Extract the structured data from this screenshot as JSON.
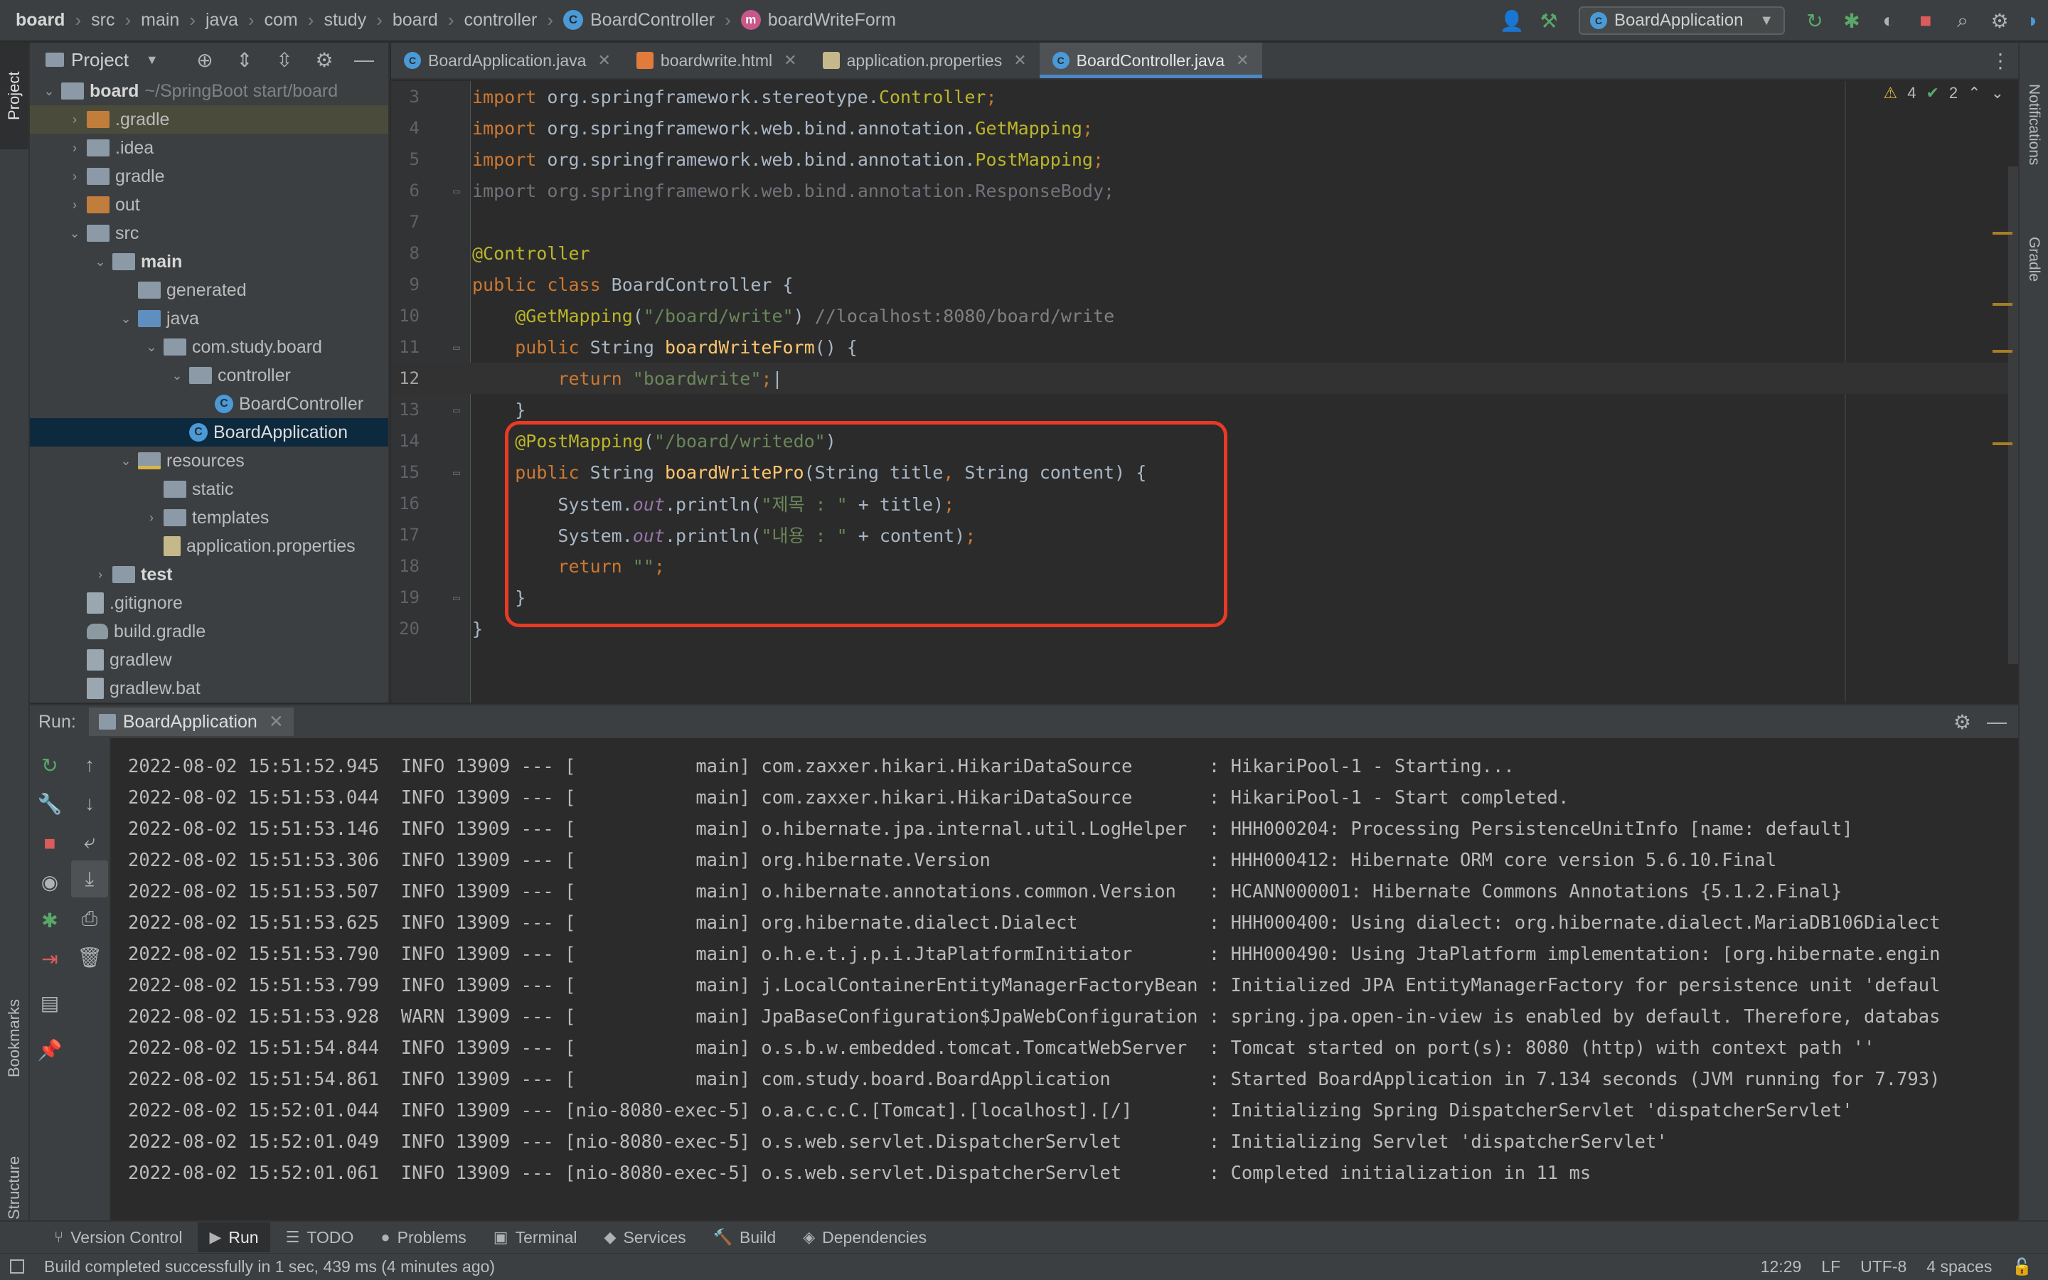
{
  "breadcrumbs": [
    "board",
    "src",
    "main",
    "java",
    "com",
    "study",
    "board",
    "controller",
    "BoardController",
    "boardWriteForm"
  ],
  "run_config": "BoardApplication",
  "icons": {
    "user": "user-icon",
    "build": "hammer-icon",
    "rerun": "rerun-icon",
    "debug": "bug-icon",
    "coverage": "coverage-icon",
    "stop": "stop-icon",
    "search": "search-icon",
    "settings": "gear-icon"
  },
  "left_tabs": {
    "project": "Project",
    "bookmarks": "Bookmarks",
    "structure": "Structure"
  },
  "right_tabs": {
    "notifications": "Notifications",
    "gradle": "Gradle"
  },
  "project": {
    "title": "Project",
    "tree": [
      {
        "label": "board",
        "hint": "~/SpringBoot start/board",
        "depth": 0,
        "arrow": "down",
        "icon": "folder",
        "bold": true
      },
      {
        "label": ".gradle",
        "depth": 1,
        "arrow": "right",
        "icon": "folder-orange",
        "style": "hover"
      },
      {
        "label": ".idea",
        "depth": 1,
        "arrow": "right",
        "icon": "folder"
      },
      {
        "label": "gradle",
        "depth": 1,
        "arrow": "right",
        "icon": "folder"
      },
      {
        "label": "out",
        "depth": 1,
        "arrow": "right",
        "icon": "folder-orange"
      },
      {
        "label": "src",
        "depth": 1,
        "arrow": "down",
        "icon": "folder"
      },
      {
        "label": "main",
        "depth": 2,
        "arrow": "down",
        "icon": "folder",
        "bold": true
      },
      {
        "label": "generated",
        "depth": 3,
        "arrow": "",
        "icon": "folder"
      },
      {
        "label": "java",
        "depth": 3,
        "arrow": "down",
        "icon": "folder-blue"
      },
      {
        "label": "com.study.board",
        "depth": 4,
        "arrow": "down",
        "icon": "folder"
      },
      {
        "label": "controller",
        "depth": 5,
        "arrow": "down",
        "icon": "folder"
      },
      {
        "label": "BoardController",
        "depth": 6,
        "arrow": "",
        "icon": "class"
      },
      {
        "label": "BoardApplication",
        "depth": 5,
        "arrow": "",
        "icon": "class",
        "style": "selected"
      },
      {
        "label": "resources",
        "depth": 3,
        "arrow": "down",
        "icon": "folder-res"
      },
      {
        "label": "static",
        "depth": 4,
        "arrow": "",
        "icon": "folder"
      },
      {
        "label": "templates",
        "depth": 4,
        "arrow": "right",
        "icon": "folder"
      },
      {
        "label": "application.properties",
        "depth": 4,
        "arrow": "",
        "icon": "prop"
      },
      {
        "label": "test",
        "depth": 2,
        "arrow": "right",
        "icon": "folder",
        "bold": true
      },
      {
        "label": ".gitignore",
        "depth": 1,
        "arrow": "",
        "icon": "file"
      },
      {
        "label": "build.gradle",
        "depth": 1,
        "arrow": "",
        "icon": "gradle"
      },
      {
        "label": "gradlew",
        "depth": 1,
        "arrow": "",
        "icon": "file"
      },
      {
        "label": "gradlew.bat",
        "depth": 1,
        "arrow": "",
        "icon": "file"
      }
    ]
  },
  "editor": {
    "tabs": [
      {
        "label": "BoardApplication.java",
        "icon": "C",
        "kind": "class",
        "active": false
      },
      {
        "label": "boardwrite.html",
        "icon": "",
        "kind": "html",
        "active": false
      },
      {
        "label": "application.properties",
        "icon": "",
        "kind": "prop",
        "active": false
      },
      {
        "label": "BoardController.java",
        "icon": "C",
        "kind": "class",
        "active": true
      }
    ],
    "inspections": {
      "warnings": "4",
      "ok": "2"
    },
    "current_line": 12,
    "lines": [
      {
        "n": "3",
        "fold": "",
        "segs": [
          [
            "kw",
            "import "
          ],
          [
            "cls",
            "org.springframework.stereotype."
          ],
          [
            "an",
            "Controller"
          ],
          [
            "kw",
            ";"
          ]
        ]
      },
      {
        "n": "4",
        "fold": "",
        "segs": [
          [
            "kw",
            "import "
          ],
          [
            "cls",
            "org.springframework.web.bind.annotation."
          ],
          [
            "an",
            "GetMapping"
          ],
          [
            "kw",
            ";"
          ]
        ]
      },
      {
        "n": "5",
        "fold": "",
        "segs": [
          [
            "kw",
            "import "
          ],
          [
            "cls",
            "org.springframework.web.bind.annotation."
          ],
          [
            "an",
            "PostMapping"
          ],
          [
            "kw",
            ";"
          ]
        ]
      },
      {
        "n": "6",
        "fold": "▭",
        "segs": [
          [
            "gray",
            "import org.springframework.web.bind.annotation.ResponseBody;"
          ]
        ]
      },
      {
        "n": "7",
        "fold": "",
        "segs": []
      },
      {
        "n": "8",
        "fold": "",
        "segs": [
          [
            "an",
            "@Controller"
          ]
        ]
      },
      {
        "n": "9",
        "fold": "",
        "segs": [
          [
            "kw",
            "public class "
          ],
          [
            "cls",
            "BoardController {"
          ]
        ]
      },
      {
        "n": "10",
        "fold": "",
        "segs": [
          [
            "cls",
            "    "
          ],
          [
            "an",
            "@GetMapping"
          ],
          [
            "cls",
            "("
          ],
          [
            "str",
            "\"/board/write\""
          ],
          [
            "cls",
            ") "
          ],
          [
            "cmt",
            "//localhost:8080/board/write"
          ]
        ]
      },
      {
        "n": "11",
        "fold": "▭",
        "segs": [
          [
            "cls",
            "    "
          ],
          [
            "kw",
            "public "
          ],
          [
            "cls",
            "String "
          ],
          [
            "fn",
            "boardWriteForm"
          ],
          [
            "cls",
            "() {"
          ]
        ]
      },
      {
        "n": "12",
        "fold": "",
        "segs": [
          [
            "cls",
            "        "
          ],
          [
            "kw",
            "return "
          ],
          [
            "str",
            "\"boardwrite\""
          ],
          [
            "kw",
            ";"
          ],
          [
            "cls",
            "|"
          ]
        ]
      },
      {
        "n": "13",
        "fold": "▭",
        "segs": [
          [
            "cls",
            "    }"
          ]
        ]
      },
      {
        "n": "14",
        "fold": "",
        "segs": [
          [
            "cls",
            "    "
          ],
          [
            "an",
            "@PostMapping"
          ],
          [
            "cls",
            "("
          ],
          [
            "str",
            "\"/board/writedo\""
          ],
          [
            "cls",
            ")"
          ]
        ]
      },
      {
        "n": "15",
        "fold": "▭",
        "segs": [
          [
            "cls",
            "    "
          ],
          [
            "kw",
            "public "
          ],
          [
            "cls",
            "String "
          ],
          [
            "fn",
            "boardWritePro"
          ],
          [
            "cls",
            "(String title"
          ],
          [
            "kw",
            ", "
          ],
          [
            "cls",
            "String content) {"
          ]
        ]
      },
      {
        "n": "16",
        "fold": "",
        "segs": [
          [
            "cls",
            "        System."
          ],
          [
            "st",
            "out"
          ],
          [
            "cls",
            ".println("
          ],
          [
            "str",
            "\"제목 : \""
          ],
          [
            "cls",
            " + title)"
          ],
          [
            "kw",
            ";"
          ]
        ]
      },
      {
        "n": "17",
        "fold": "",
        "segs": [
          [
            "cls",
            "        System."
          ],
          [
            "st",
            "out"
          ],
          [
            "cls",
            ".println("
          ],
          [
            "str",
            "\"내용 : \""
          ],
          [
            "cls",
            " + content)"
          ],
          [
            "kw",
            ";"
          ]
        ]
      },
      {
        "n": "18",
        "fold": "",
        "segs": [
          [
            "cls",
            "        "
          ],
          [
            "kw",
            "return "
          ],
          [
            "str",
            "\"\""
          ],
          [
            "kw",
            ";"
          ]
        ]
      },
      {
        "n": "19",
        "fold": "▭",
        "segs": [
          [
            "cls",
            "    }"
          ]
        ]
      },
      {
        "n": "20",
        "fold": "",
        "segs": [
          [
            "cls",
            "}"
          ]
        ]
      }
    ]
  },
  "run": {
    "label": "Run:",
    "tab": "BoardApplication",
    "log": [
      "2022-08-02 15:51:52.945  INFO 13909 --- [           main] com.zaxxer.hikari.HikariDataSource       : HikariPool-1 - Starting...",
      "2022-08-02 15:51:53.044  INFO 13909 --- [           main] com.zaxxer.hikari.HikariDataSource       : HikariPool-1 - Start completed.",
      "2022-08-02 15:51:53.146  INFO 13909 --- [           main] o.hibernate.jpa.internal.util.LogHelper  : HHH000204: Processing PersistenceUnitInfo [name: default]",
      "2022-08-02 15:51:53.306  INFO 13909 --- [           main] org.hibernate.Version                    : HHH000412: Hibernate ORM core version 5.6.10.Final",
      "2022-08-02 15:51:53.507  INFO 13909 --- [           main] o.hibernate.annotations.common.Version   : HCANN000001: Hibernate Commons Annotations {5.1.2.Final}",
      "2022-08-02 15:51:53.625  INFO 13909 --- [           main] org.hibernate.dialect.Dialect            : HHH000400: Using dialect: org.hibernate.dialect.MariaDB106Dialect",
      "2022-08-02 15:51:53.790  INFO 13909 --- [           main] o.h.e.t.j.p.i.JtaPlatformInitiator       : HHH000490: Using JtaPlatform implementation: [org.hibernate.engin",
      "2022-08-02 15:51:53.799  INFO 13909 --- [           main] j.LocalContainerEntityManagerFactoryBean : Initialized JPA EntityManagerFactory for persistence unit 'defaul",
      "2022-08-02 15:51:53.928  WARN 13909 --- [           main] JpaBaseConfiguration$JpaWebConfiguration : spring.jpa.open-in-view is enabled by default. Therefore, databas",
      "2022-08-02 15:51:54.844  INFO 13909 --- [           main] o.s.b.w.embedded.tomcat.TomcatWebServer  : Tomcat started on port(s): 8080 (http) with context path ''",
      "2022-08-02 15:51:54.861  INFO 13909 --- [           main] com.study.board.BoardApplication         : Started BoardApplication in 7.134 seconds (JVM running for 7.793)",
      "2022-08-02 15:52:01.044  INFO 13909 --- [nio-8080-exec-5] o.a.c.c.C.[Tomcat].[localhost].[/]       : Initializing Spring DispatcherServlet 'dispatcherServlet'",
      "2022-08-02 15:52:01.049  INFO 13909 --- [nio-8080-exec-5] o.s.web.servlet.DispatcherServlet        : Initializing Servlet 'dispatcherServlet'",
      "2022-08-02 15:52:01.061  INFO 13909 --- [nio-8080-exec-5] o.s.web.servlet.DispatcherServlet        : Completed initialization in 11 ms"
    ]
  },
  "toolwindows": [
    {
      "label": "Version Control",
      "icon": "⑂",
      "name": "version-control-icon",
      "active": false
    },
    {
      "label": "Run",
      "icon": "▶",
      "name": "run-icon",
      "active": true
    },
    {
      "label": "TODO",
      "icon": "☰",
      "name": "todo-icon",
      "active": false
    },
    {
      "label": "Problems",
      "icon": "●",
      "name": "problems-icon",
      "active": false
    },
    {
      "label": "Terminal",
      "icon": "▣",
      "name": "terminal-icon",
      "active": false
    },
    {
      "label": "Services",
      "icon": "◆",
      "name": "services-icon",
      "active": false
    },
    {
      "label": "Build",
      "icon": "🔨",
      "name": "build-icon",
      "active": false
    },
    {
      "label": "Dependencies",
      "icon": "◈",
      "name": "dependencies-icon",
      "active": false
    }
  ],
  "status": {
    "message": "Build completed successfully in 1 sec, 439 ms (4 minutes ago)",
    "position": "12:29",
    "line_sep": "LF",
    "encoding": "UTF-8",
    "indent": "4 spaces"
  }
}
